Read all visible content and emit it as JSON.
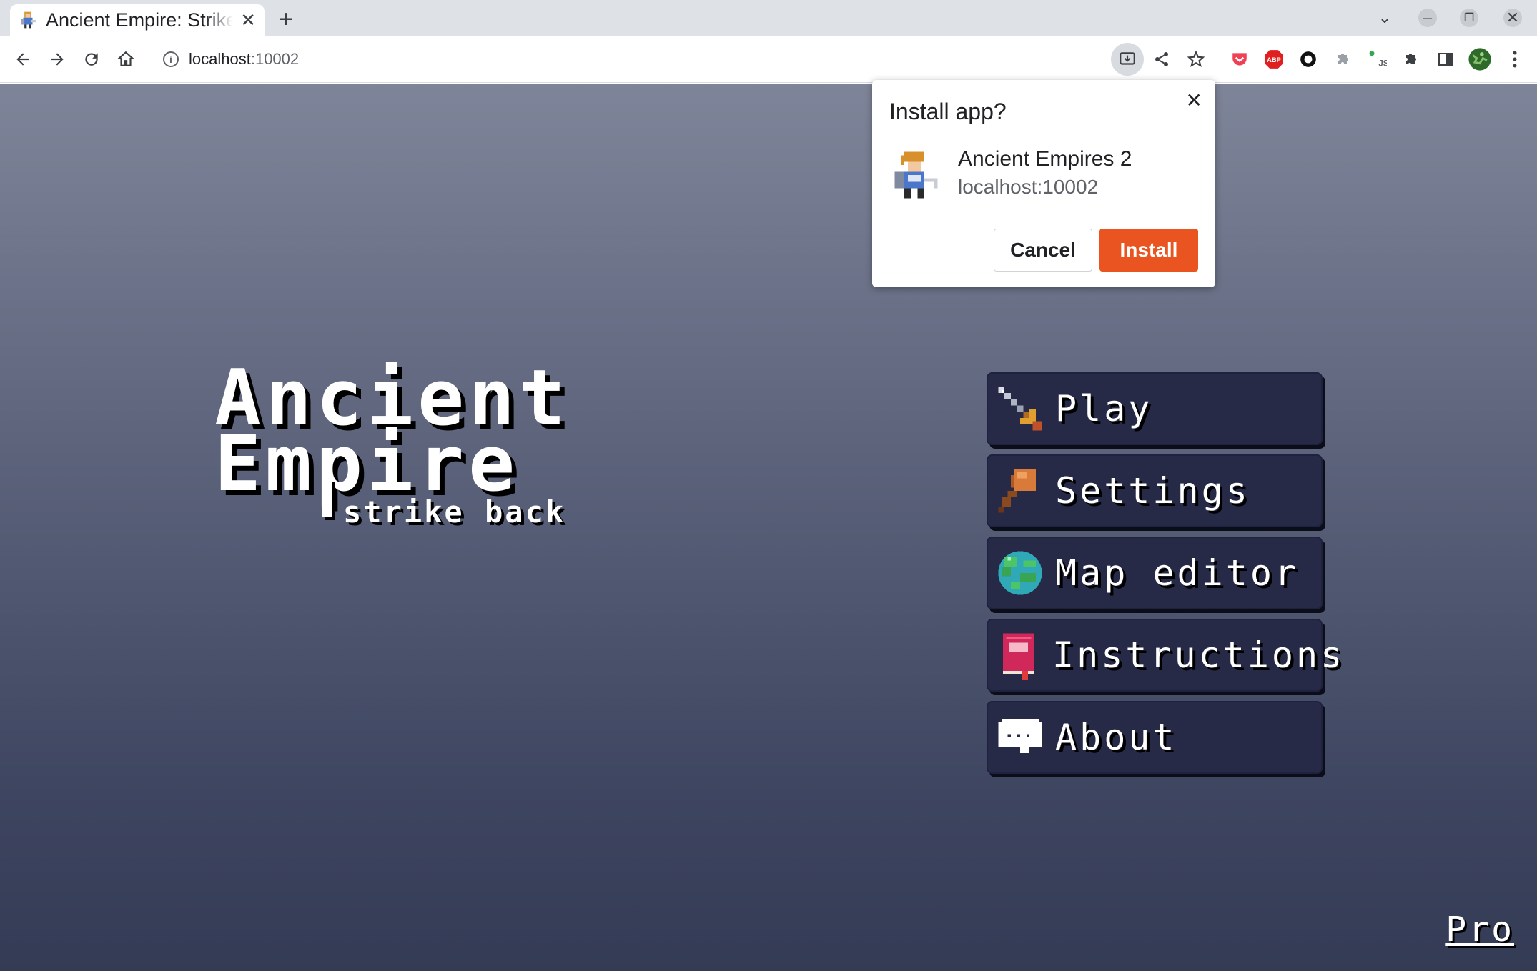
{
  "browser": {
    "tab_title": "Ancient Empire: Strike Back",
    "url_host": "localhost",
    "url_port": ":10002"
  },
  "logo": {
    "line1": "Ancient",
    "line2": "Empire",
    "subtitle": "strike back"
  },
  "menu": {
    "items": [
      {
        "label": "Play",
        "icon": "sword-icon"
      },
      {
        "label": "Settings",
        "icon": "hammer-icon"
      },
      {
        "label": "Map editor",
        "icon": "globe-icon"
      },
      {
        "label": "Instructions",
        "icon": "book-icon"
      },
      {
        "label": "About",
        "icon": "speech-bubble-icon"
      }
    ]
  },
  "pro_link": "Pro",
  "install_popup": {
    "title": "Install app?",
    "app_name": "Ancient Empires 2",
    "origin": "localhost:10002",
    "cancel_label": "Cancel",
    "install_label": "Install"
  },
  "colors": {
    "install_accent": "#e95420",
    "menu_button_bg": "#262a47"
  }
}
